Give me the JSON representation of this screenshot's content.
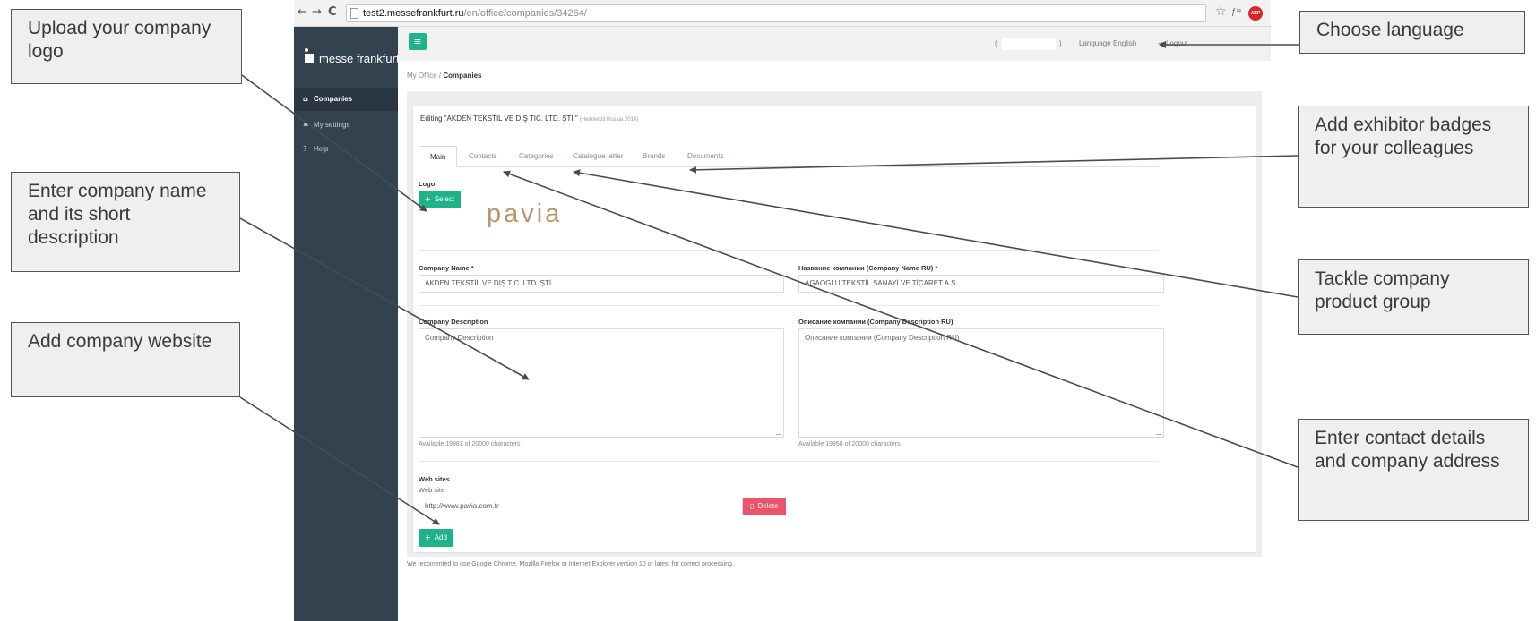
{
  "browser": {
    "url_host": "test2.messefrankfurt.ru",
    "url_path": "/en/office/companies/34264/"
  },
  "app": {
    "logo_text": "messe frankfurt",
    "sidebar": {
      "items": [
        {
          "label": "Companies",
          "icon": "bank-icon"
        },
        {
          "label": "My settings",
          "icon": "gear-icon"
        },
        {
          "label": "Help",
          "icon": "help-icon"
        }
      ]
    },
    "header": {
      "user_prefix": "(",
      "user_suffix": ")",
      "language_label": "Language",
      "language_value": "English",
      "logout_label": "Logout"
    },
    "breadcrumb": {
      "root": "My Office",
      "separator": "/",
      "current": "Companies"
    },
    "editing": {
      "title": "Editing \"AKDEN TEKSTİL VE DIŞ TİC. LTD. ŞTİ.\"",
      "event": "(Heimtextil Russia 2014)"
    },
    "tabs": [
      "Main",
      "Contacts",
      "Categories",
      "Catalogue letter",
      "Brands",
      "Documents"
    ],
    "logo_section": {
      "label": "Logo",
      "select_label": "Select",
      "logo_wordmark": "pavia"
    },
    "company_name": {
      "label": "Company Name *",
      "value": "AKDEN TEKSTİL VE DIŞ TİC. LTD. ŞTİ."
    },
    "company_name_ru": {
      "label": "Название компании (Company Name RU) *",
      "value": "AGAOGLU TEKSTİL SANAYİ VE TİCARET A.S."
    },
    "company_description": {
      "label": "Company Description",
      "placeholder": "Company Description",
      "counter": "Available 19981 of 20000 characters"
    },
    "company_description_ru": {
      "label": "Описание компании (Company Description RU)",
      "placeholder": "Описание компании (Company Description RU)",
      "counter": "Available 19958 of 20000 characters"
    },
    "web_sites": {
      "section_label": "Web sites",
      "field_label": "Web site",
      "value": "http://www.pavia.com.tr",
      "delete_label": "Delete",
      "add_label": "Add"
    },
    "footer_note": "We recomented to use Google Chrome, Mozilla Firefox or Internet Explorer version 10 or latest for correct processing."
  },
  "callouts": {
    "upload_logo": "Upload your company logo",
    "enter_name": "Enter company name and its short description",
    "add_website": "Add company website",
    "choose_language": "Choose language",
    "add_badges": "Add exhibitor badges for your colleagues",
    "product_group": "Tackle company product group",
    "contact_details": "Enter contact details and company address"
  },
  "colors": {
    "sidebar_bg": "#33424f",
    "accent_green": "#1fb38a",
    "danger_red": "#e9546b",
    "callout_bg": "#efefef",
    "arrow": "#4a4a55"
  }
}
